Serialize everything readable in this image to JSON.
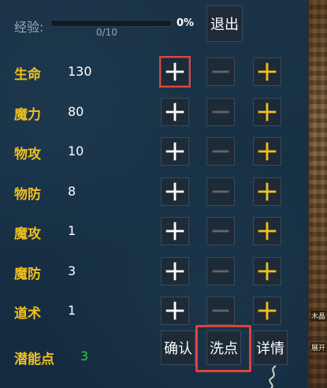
{
  "header": {
    "exp_label": "经验:",
    "exp_count": "0/10",
    "exp_percent": "0%",
    "exp_progress": 0,
    "quit_label": "退出"
  },
  "stats": [
    {
      "name": "生命",
      "value": "130"
    },
    {
      "name": "魔力",
      "value": "80"
    },
    {
      "name": "物攻",
      "value": "10"
    },
    {
      "name": "物防",
      "value": "8"
    },
    {
      "name": "魔攻",
      "value": "1"
    },
    {
      "name": "魔防",
      "value": "3"
    },
    {
      "name": "道术",
      "value": "1"
    }
  ],
  "footer": {
    "potential_label": "潜能点",
    "potential_value": "3",
    "confirm_label": "确认",
    "reset_label": "洗点",
    "detail_label": "详情"
  },
  "side_strip": {
    "tag_top": "木晶",
    "tag_bottom": "展开"
  },
  "colors": {
    "label_gold": "#f0c020",
    "potential_green": "#30d040",
    "highlight_red": "#e04040",
    "minus_gray": "#5a6674"
  }
}
